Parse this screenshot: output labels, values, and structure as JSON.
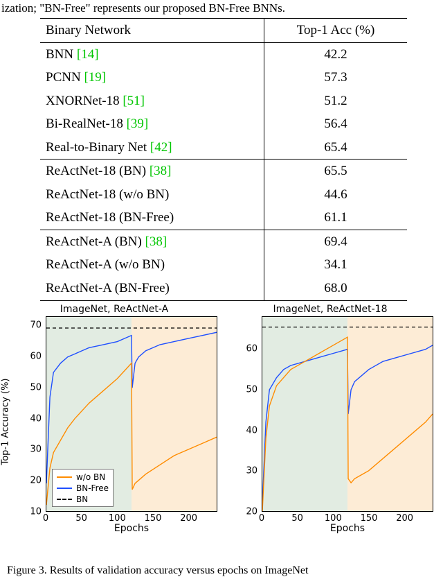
{
  "fragment_text": "ization; \"BN-Free\" represents our proposed BN-Free BNNs.",
  "table": {
    "header": {
      "col1": "Binary Network",
      "col2": "Top-1 Acc (%)"
    },
    "rows": [
      {
        "name": "BNN ",
        "cite": "[14]",
        "acc": "42.2"
      },
      {
        "name": "PCNN ",
        "cite": "[19]",
        "acc": "57.3"
      },
      {
        "name": "XNORNet-18 ",
        "cite": "[51]",
        "acc": "51.2"
      },
      {
        "name": "Bi-RealNet-18 ",
        "cite": "[39]",
        "acc": "56.4"
      },
      {
        "name": "Real-to-Binary Net ",
        "cite": "[42]",
        "acc": "65.4"
      },
      {
        "name": "ReActNet-18 (BN) ",
        "cite": "[38]",
        "acc": "65.5"
      },
      {
        "name": "ReActNet-18 (w/o BN)",
        "cite": "",
        "acc": "44.6"
      },
      {
        "name": "ReActNet-18 (BN-Free)",
        "cite": "",
        "acc": "61.1"
      },
      {
        "name": "ReActNet-A (BN) ",
        "cite": "[38]",
        "acc": "69.4"
      },
      {
        "name": "ReActNet-A (w/o BN)",
        "cite": "",
        "acc": "34.1"
      },
      {
        "name": "ReActNet-A (BN-Free)",
        "cite": "",
        "acc": "68.0"
      }
    ]
  },
  "charts": {
    "xlabel": "Epochs",
    "ylabel": "Top-1 Accuracy (%)",
    "legend": {
      "wo": "w/o BN",
      "bnfree": "BN-Free",
      "bn": "BN"
    },
    "left": {
      "title": "ImageNet, ReActNet-A",
      "ylim": [
        10,
        73
      ],
      "xlim": [
        0,
        240
      ],
      "yticks": [
        10,
        20,
        30,
        40,
        50,
        60,
        70
      ],
      "xticks": [
        0,
        50,
        100,
        150,
        200
      ]
    },
    "right": {
      "title": "ImageNet, ReActNet-18",
      "ylim": [
        20,
        68
      ],
      "xlim": [
        0,
        240
      ],
      "yticks": [
        20,
        30,
        40,
        50,
        60
      ],
      "xticks": [
        0,
        50,
        100,
        150,
        200
      ]
    }
  },
  "fig_caption_fragment": "Figure 3. Results of validation accuracy versus epochs on ImageNet",
  "chart_data": [
    {
      "type": "line",
      "title": "ImageNet, ReActNet-A",
      "xlabel": "Epochs",
      "ylabel": "Top-1 Accuracy (%)",
      "xlim": [
        0,
        240
      ],
      "ylim": [
        10,
        73
      ],
      "bn_reference": 69.4,
      "series": [
        {
          "name": "BN-Free",
          "color": "#1f4fff",
          "x": [
            0,
            5,
            10,
            20,
            30,
            40,
            50,
            60,
            80,
            100,
            120,
            121,
            125,
            130,
            140,
            160,
            180,
            200,
            220,
            240
          ],
          "y": [
            19,
            47,
            55,
            58,
            60,
            61,
            62,
            63,
            64,
            65,
            67,
            50,
            58,
            60,
            62,
            64,
            65,
            66,
            67,
            68
          ]
        },
        {
          "name": "w/o BN",
          "color": "#ff8c00",
          "x": [
            0,
            5,
            10,
            20,
            30,
            40,
            60,
            80,
            100,
            120,
            121,
            125,
            130,
            140,
            160,
            180,
            200,
            220,
            240
          ],
          "y": [
            12,
            24,
            29,
            33,
            37,
            40,
            45,
            49,
            53,
            58,
            17,
            19,
            20,
            22,
            25,
            28,
            30,
            32,
            34
          ]
        },
        {
          "name": "BN",
          "style": "dashed",
          "color": "#000000",
          "x": [
            0,
            240
          ],
          "y": [
            69.4,
            69.4
          ]
        }
      ]
    },
    {
      "type": "line",
      "title": "ImageNet, ReActNet-18",
      "xlabel": "Epochs",
      "ylabel": "Top-1 Accuracy (%)",
      "xlim": [
        0,
        240
      ],
      "ylim": [
        20,
        68
      ],
      "bn_reference": 65.5,
      "series": [
        {
          "name": "BN-Free",
          "color": "#1f4fff",
          "x": [
            0,
            5,
            10,
            20,
            30,
            40,
            60,
            80,
            100,
            120,
            121,
            125,
            130,
            150,
            170,
            190,
            210,
            230,
            240
          ],
          "y": [
            22,
            42,
            50,
            53,
            55,
            56,
            57,
            58,
            59,
            60,
            44,
            50,
            52,
            55,
            57,
            58,
            59,
            60,
            61
          ]
        },
        {
          "name": "w/o BN",
          "color": "#ff8c00",
          "x": [
            0,
            5,
            10,
            20,
            40,
            60,
            80,
            100,
            120,
            121,
            125,
            130,
            140,
            150,
            170,
            190,
            210,
            230,
            240
          ],
          "y": [
            20,
            38,
            46,
            51,
            55,
            57,
            59,
            61,
            63,
            28,
            27,
            28,
            29,
            30,
            33,
            36,
            39,
            42,
            44
          ]
        },
        {
          "name": "BN",
          "style": "dashed",
          "color": "#000000",
          "x": [
            0,
            240
          ],
          "y": [
            65.5,
            65.5
          ]
        }
      ]
    }
  ]
}
